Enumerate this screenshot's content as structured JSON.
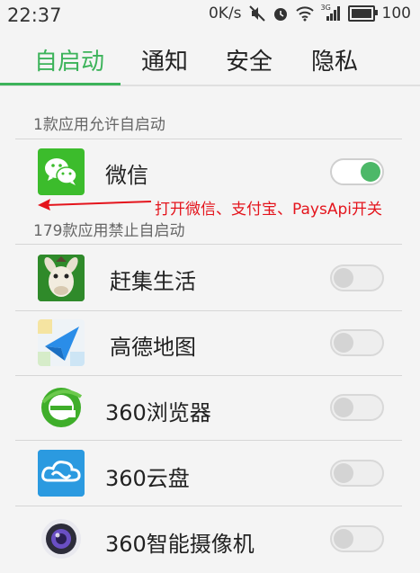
{
  "status_bar": {
    "time": "22:37",
    "network_speed": "0K/s",
    "signal_type": "3G",
    "battery": "100",
    "icons": [
      "mute-icon",
      "alarm-icon",
      "wifi-icon",
      "signal-icon",
      "battery-icon"
    ]
  },
  "tabs": [
    {
      "label": "自启动",
      "active": true
    },
    {
      "label": "通知",
      "active": false
    },
    {
      "label": "安全",
      "active": false
    },
    {
      "label": "隐私",
      "active": false
    }
  ],
  "allowed_section": {
    "header": "1款应用允许自启动",
    "apps": [
      {
        "name": "微信",
        "enabled": true,
        "icon": "wechat-icon"
      }
    ]
  },
  "forbidden_section": {
    "header": "179款应用禁止自启动",
    "apps": [
      {
        "name": "赶集生活",
        "enabled": false,
        "icon": "ganji-icon"
      },
      {
        "name": "高德地图",
        "enabled": false,
        "icon": "amap-icon"
      },
      {
        "name": "360浏览器",
        "enabled": false,
        "icon": "360-browser-icon"
      },
      {
        "name": "360云盘",
        "enabled": false,
        "icon": "360-cloud-icon"
      },
      {
        "name": "360智能摄像机",
        "enabled": false,
        "icon": "360-camera-icon"
      }
    ]
  },
  "annotation": {
    "text": "打开微信、支付宝、PaysApi开关",
    "color": "#e4141c"
  },
  "colors": {
    "accent": "#3cb35a",
    "toggle_on": "#4cb868"
  }
}
